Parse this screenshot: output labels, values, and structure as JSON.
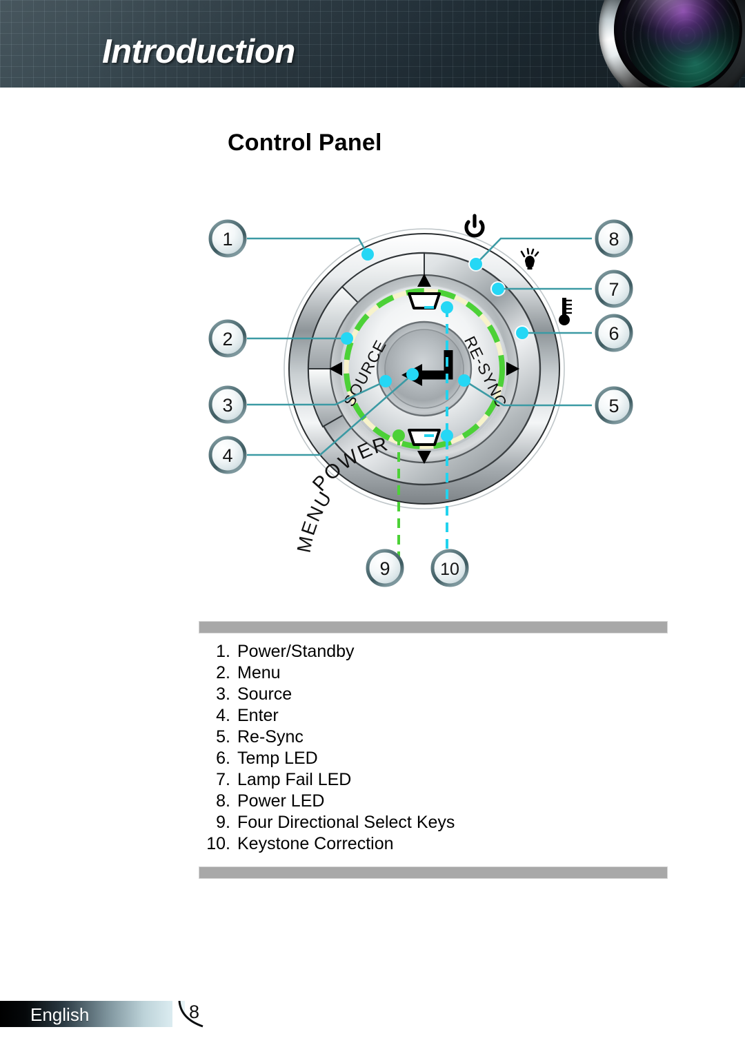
{
  "header": {
    "title": "Introduction",
    "lens_icon": "camera-lens-graphic"
  },
  "section": {
    "title": "Control Panel"
  },
  "diagram": {
    "name": "control-panel-diagram",
    "panel_labels": {
      "power": "POWER",
      "menu": "MENU",
      "source": "SOURCE",
      "resync": "RE-SYNC"
    },
    "icons": {
      "power_standby": "power-symbol-icon",
      "lamp_fail": "lamp-bulb-icon",
      "temp": "thermometer-icon",
      "enter": "enter-return-arrow-icon",
      "keystone_up": "keystone-trapezoid-up-icon",
      "keystone_down": "keystone-trapezoid-down-icon",
      "arrow_up": "triangle-up-icon",
      "arrow_down": "triangle-down-icon",
      "arrow_left": "triangle-left-icon",
      "arrow_right": "triangle-right-icon"
    },
    "callouts": [
      {
        "number": "1",
        "target": "power-standby-button"
      },
      {
        "number": "2",
        "target": "menu-button"
      },
      {
        "number": "3",
        "target": "source-button"
      },
      {
        "number": "4",
        "target": "enter-button"
      },
      {
        "number": "5",
        "target": "re-sync-button"
      },
      {
        "number": "6",
        "target": "temp-led"
      },
      {
        "number": "7",
        "target": "lamp-fail-led"
      },
      {
        "number": "8",
        "target": "power-led"
      },
      {
        "number": "9",
        "target": "four-directional-select-keys"
      },
      {
        "number": "10",
        "target": "keystone-correction"
      }
    ],
    "colors": {
      "leader_line": "#3b9aa4",
      "callout_dot": "#25d7f5",
      "directional_highlight": "#4cd137",
      "keystone_highlight": "#22d3ee",
      "inner_ring": "#f7f3cb"
    }
  },
  "legend": {
    "items": [
      {
        "num": "1.",
        "label": "Power/Standby"
      },
      {
        "num": "2.",
        "label": "Menu"
      },
      {
        "num": "3.",
        "label": "Source"
      },
      {
        "num": "4.",
        "label": "Enter"
      },
      {
        "num": "5.",
        "label": "Re-Sync"
      },
      {
        "num": "6.",
        "label": "Temp LED"
      },
      {
        "num": "7.",
        "label": "Lamp Fail LED"
      },
      {
        "num": "8.",
        "label": "Power LED"
      },
      {
        "num": "9.",
        "label": "Four Directional Select Keys"
      },
      {
        "num": "10.",
        "label": "Keystone Correction"
      }
    ]
  },
  "footer": {
    "language": "English",
    "page_number": "8"
  }
}
